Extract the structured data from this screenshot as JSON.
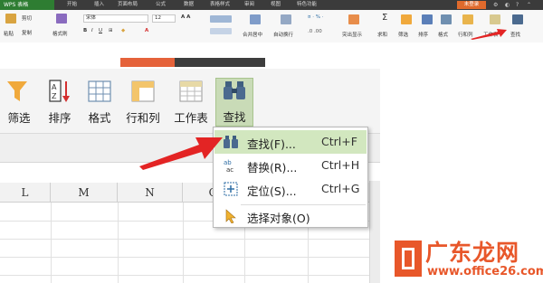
{
  "mini": {
    "app_title": "WPS 表格",
    "menu": [
      "开始",
      "插入",
      "页面布局",
      "公式",
      "数据",
      "表格样式",
      "审阅",
      "视图",
      "特色功能"
    ],
    "login": "未登录",
    "clipboard": {
      "paste": "粘贴",
      "cut": "剪切",
      "copy": "复制",
      "format_painter": "格式刷"
    },
    "font_name": "宋体",
    "font_size": "12",
    "merge": "合并居中",
    "wrap": "自动换行",
    "tools": [
      "突出显示",
      "求和",
      "筛选",
      "排序",
      "格式",
      "行和列",
      "工作表",
      "查找"
    ]
  },
  "ribbon": {
    "buttons": [
      {
        "label": "筛选"
      },
      {
        "label": "排序"
      },
      {
        "label": "格式"
      },
      {
        "label": "行和列"
      },
      {
        "label": "工作表"
      },
      {
        "label": "查找"
      }
    ]
  },
  "columns": [
    "L",
    "M",
    "N",
    "O"
  ],
  "dropdown": {
    "items": [
      {
        "label": "查找(F)...",
        "shortcut": "Ctrl+F"
      },
      {
        "label": "替换(R)...",
        "shortcut": "Ctrl+H"
      },
      {
        "label": "定位(S)...",
        "shortcut": "Ctrl+G"
      },
      {
        "label": "选择对象(O)",
        "shortcut": ""
      }
    ]
  },
  "watermark": {
    "name": "广东龙网",
    "url": "www.office26.com"
  },
  "colors": {
    "accent_green": "#c9dbb7",
    "highlight": "#d2e7bf",
    "arrow_red": "#e32424",
    "watermark": "#e8572a"
  }
}
